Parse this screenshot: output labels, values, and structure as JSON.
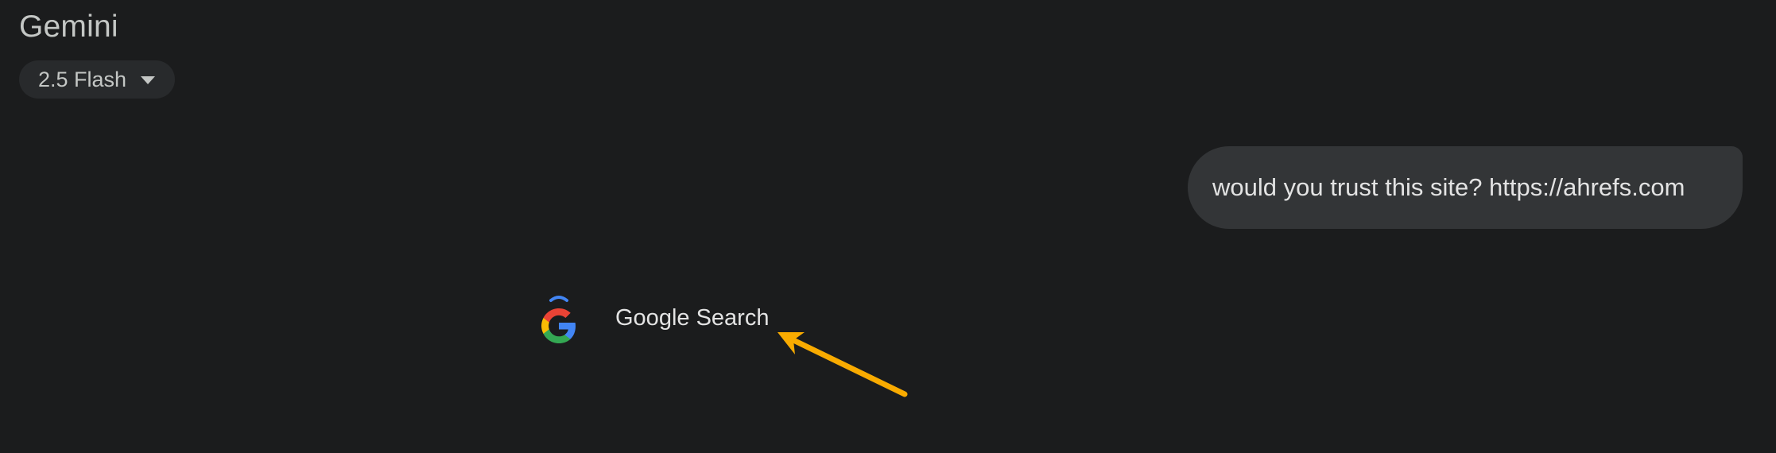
{
  "header": {
    "title": "Gemini",
    "model_picker_label": "2.5 Flash"
  },
  "chat": {
    "user_message": "would you trust this site? https://ahrefs.com",
    "tool_call": {
      "icon": "google-g-icon",
      "label": "Google Search"
    }
  },
  "annotation": {
    "arrow_color": "#f9ab00"
  },
  "colors": {
    "background": "#1b1c1d",
    "bubble": "#333537",
    "picker": "#282a2c",
    "google_blue": "#4285f4",
    "google_red": "#ea4335",
    "google_yellow": "#fbbc05",
    "google_green": "#34a853"
  }
}
